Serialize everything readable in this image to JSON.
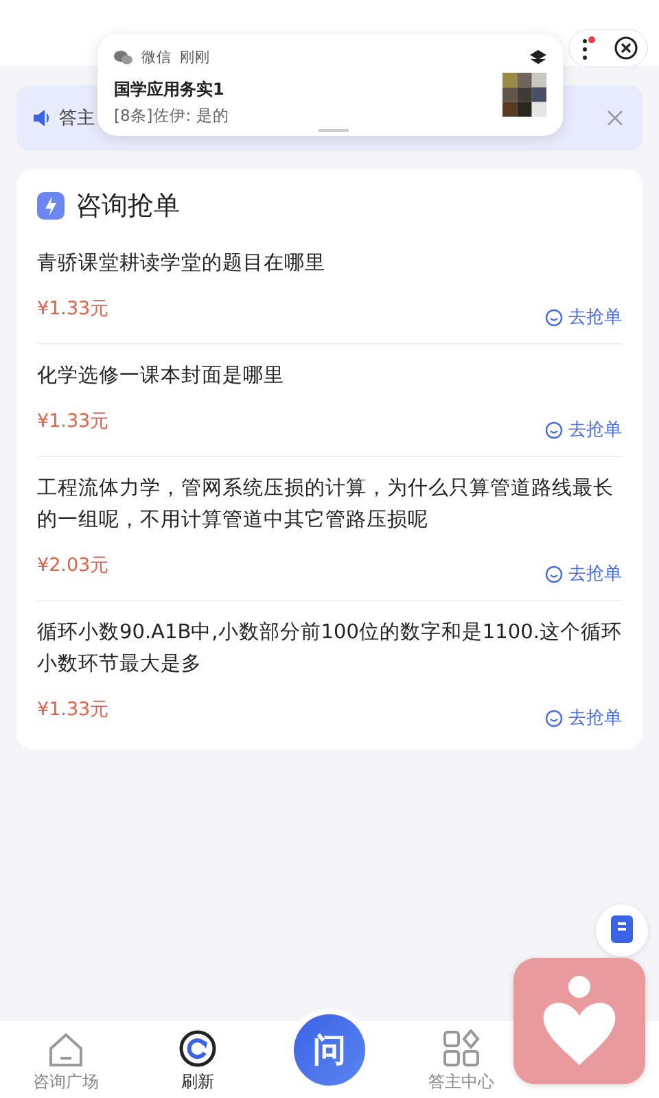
{
  "notification": {
    "app": "微信",
    "time": "刚刚",
    "title": "国学应用务实1",
    "message": "[8条]佐伊: 是的"
  },
  "notice": {
    "text": "答主"
  },
  "section": {
    "title": "咨询抢单"
  },
  "questions": [
    {
      "text": "青骄课堂耕读学堂的题目在哪里",
      "price": "¥1.33元",
      "action": "去抢单"
    },
    {
      "text": "化学选修一课本封面是哪里",
      "price": "¥1.33元",
      "action": "去抢单"
    },
    {
      "text": "工程流体力学，管网系统压损的计算，为什么只算管道路线最长的一组呢，不用计算管道中其它管路压损呢",
      "price": "¥2.03元",
      "action": "去抢单"
    },
    {
      "text": "循环小数90.A1B中,小数部分前100位的数字和是1100.这个循环小数环节最大是多",
      "price": "¥1.33元",
      "action": "去抢单"
    }
  ],
  "tabs": [
    {
      "kind": "home",
      "label": "咨询广场",
      "selected": false
    },
    {
      "kind": "refresh",
      "label": "刷新",
      "selected": true
    },
    {
      "kind": "ask",
      "label": "问",
      "selected": false
    },
    {
      "kind": "grid",
      "label": "答主中心",
      "selected": false
    }
  ]
}
